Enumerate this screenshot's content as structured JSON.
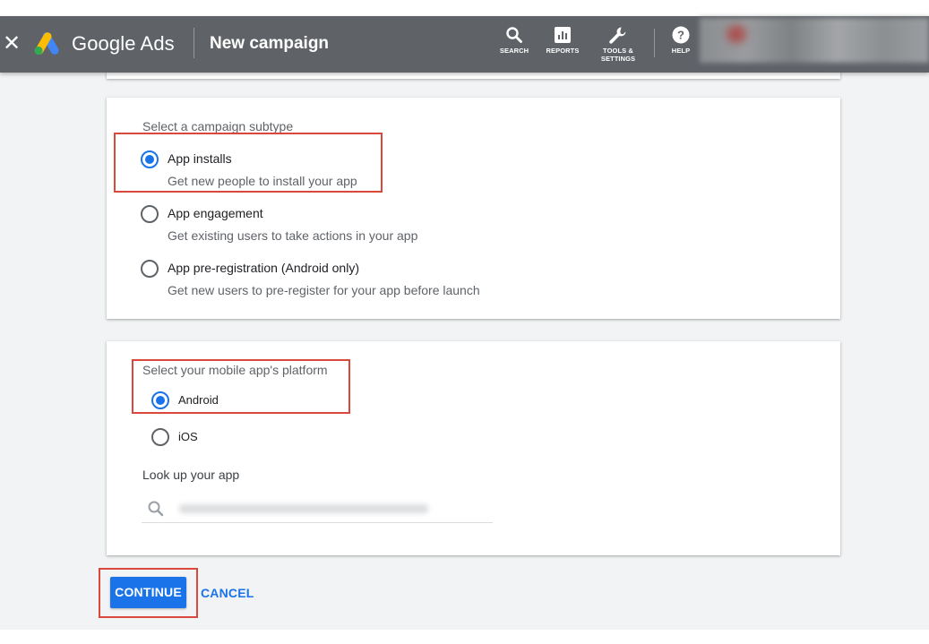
{
  "header": {
    "brand": "Google Ads",
    "title": "New campaign",
    "tools": [
      {
        "label": "SEARCH",
        "icon": "search-icon"
      },
      {
        "label": "REPORTS",
        "icon": "reports-icon"
      },
      {
        "label_line1": "TOOLS &",
        "label_line2": "SETTINGS",
        "icon": "wrench-icon"
      },
      {
        "label": "HELP",
        "icon": "help-icon"
      }
    ]
  },
  "subtype": {
    "label": "Select a campaign subtype",
    "selected": "app_installs",
    "options": [
      {
        "title": "App installs",
        "description": "Get new people to install your app",
        "checked": true
      },
      {
        "title": "App engagement",
        "description": "Get existing users to take actions in your app",
        "checked": false
      },
      {
        "title": "App pre-registration (Android only)",
        "description": "Get new users to pre-register for your app before launch",
        "checked": false
      }
    ]
  },
  "platform": {
    "label": "Select your mobile app's platform",
    "options": [
      {
        "title": "Android",
        "checked": true
      },
      {
        "title": "iOS",
        "checked": false
      }
    ],
    "lookup_label": "Look up your app"
  },
  "actions": {
    "continue_label": "CONTINUE",
    "cancel_label": "CANCEL"
  },
  "colors": {
    "header_bg": "#5f6368",
    "primary_blue": "#1a73e8",
    "highlight_red": "#d9483b",
    "page_bg": "#f1f3f4"
  }
}
